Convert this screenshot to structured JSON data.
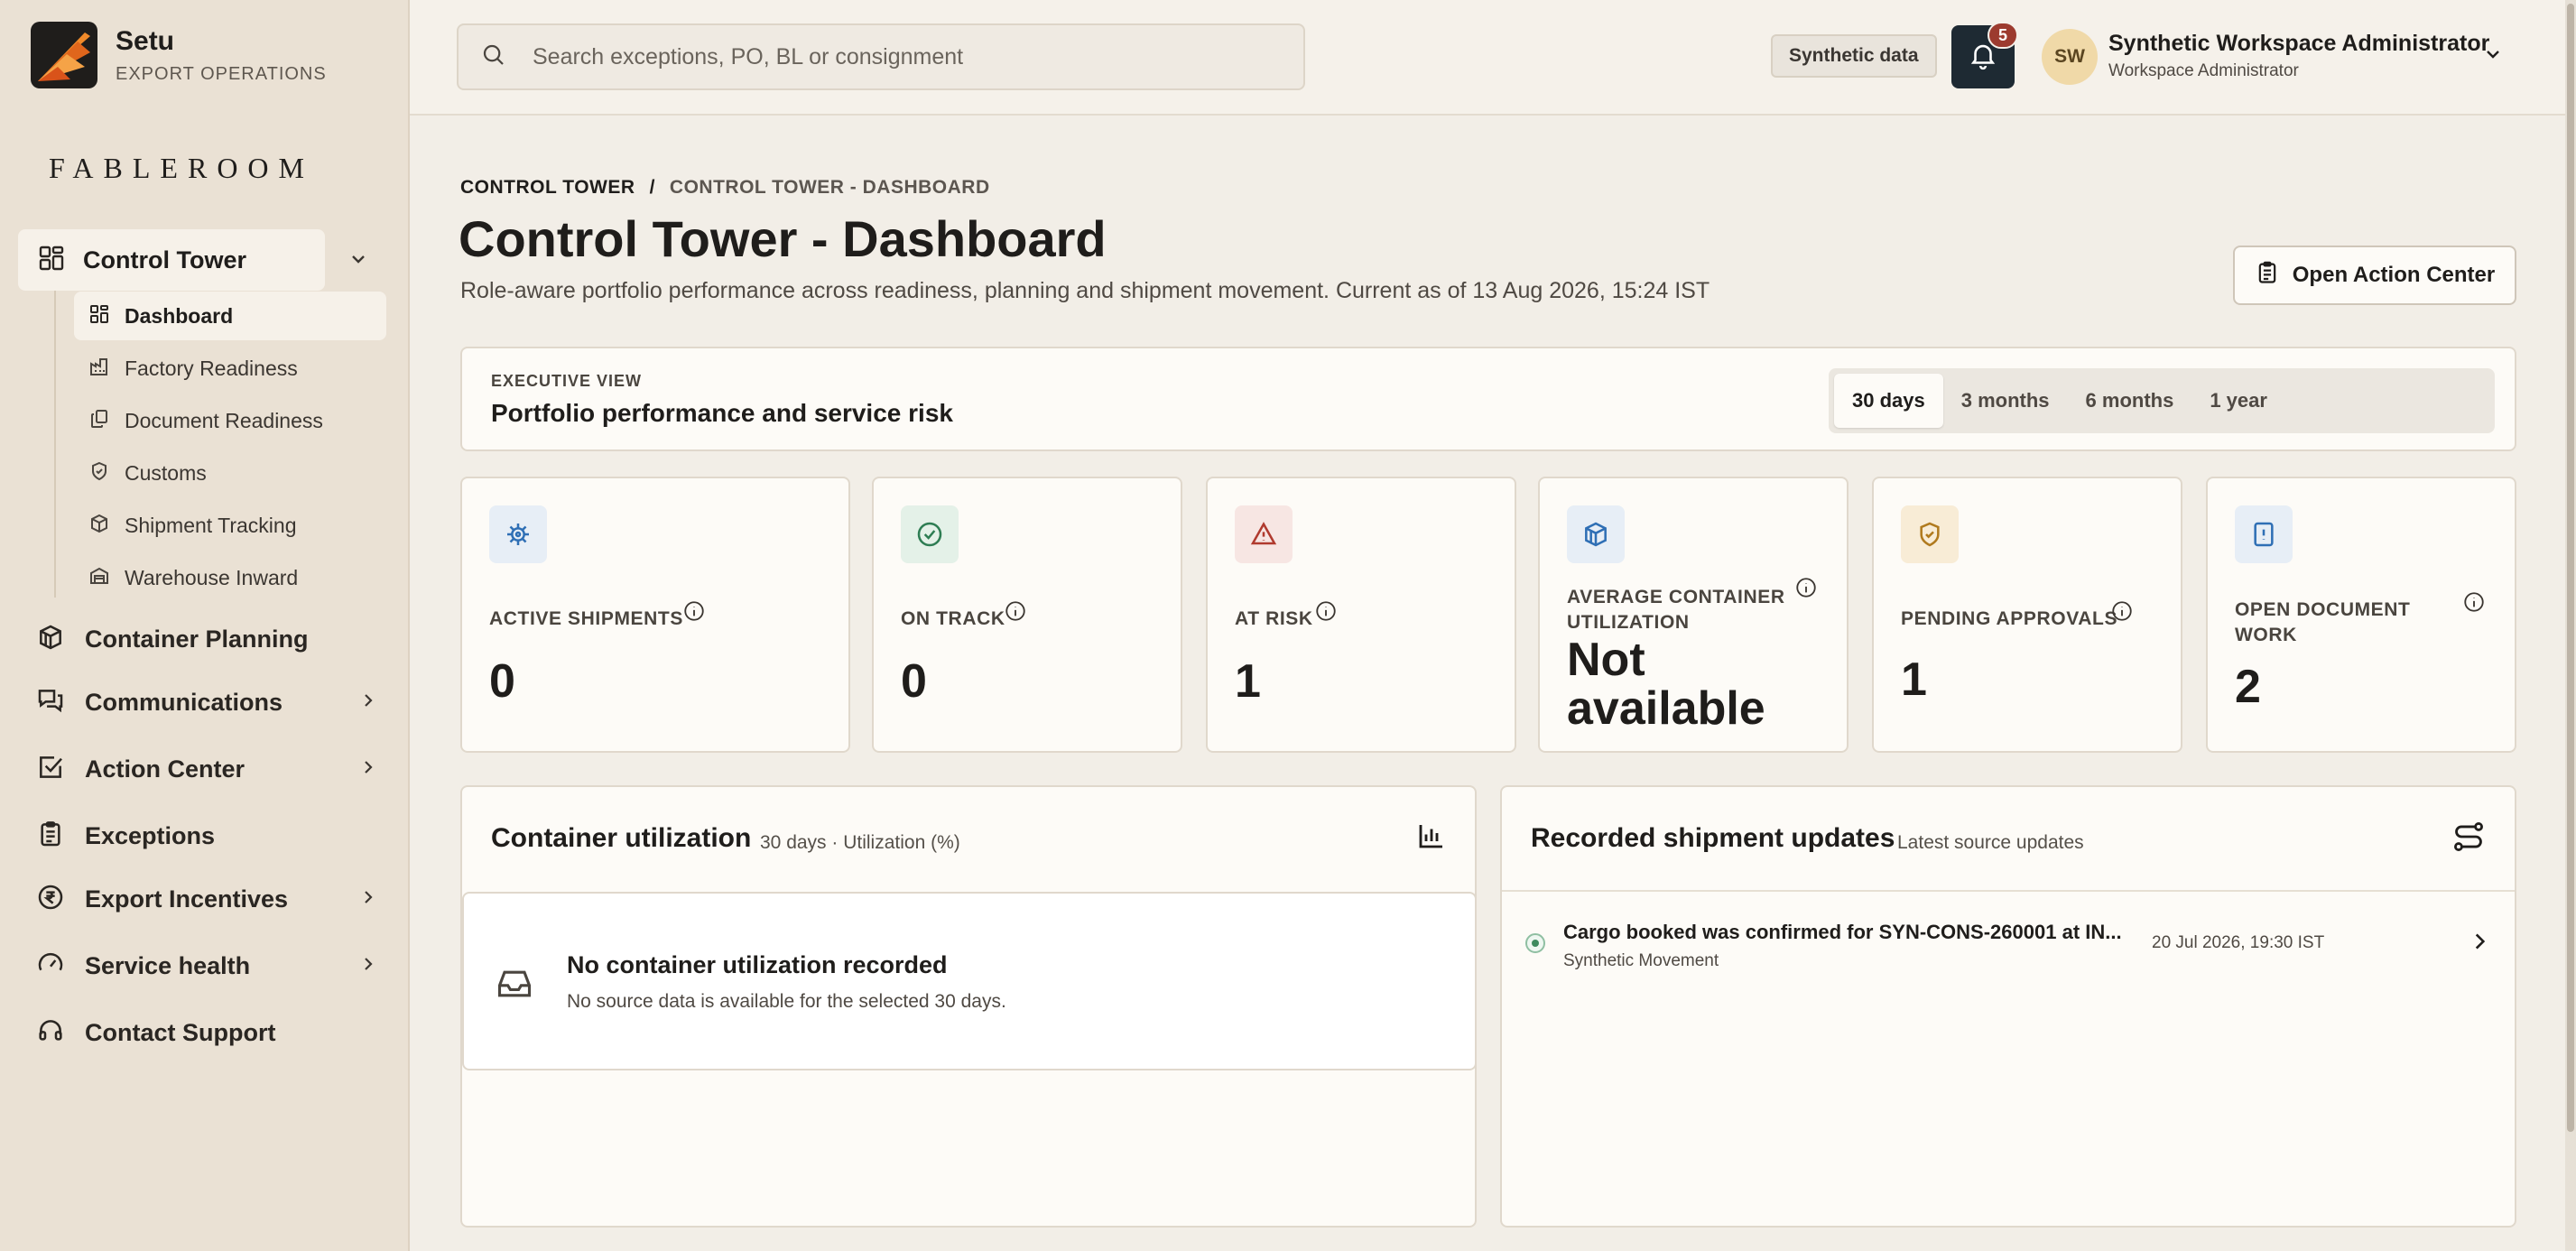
{
  "brand": {
    "name": "Setu",
    "subtitle": "EXPORT OPERATIONS",
    "wordmark": "FABLEROOM"
  },
  "sidebar": {
    "group": {
      "label": "Control Tower",
      "expanded": true
    },
    "sub_items": [
      {
        "label": "Dashboard",
        "active": true,
        "icon": "dashboard-icon"
      },
      {
        "label": "Factory Readiness",
        "icon": "factory-icon"
      },
      {
        "label": "Document Readiness",
        "icon": "documents-icon"
      },
      {
        "label": "Customs",
        "icon": "shield-icon"
      },
      {
        "label": "Shipment Tracking",
        "icon": "box-icon"
      },
      {
        "label": "Warehouse Inward",
        "icon": "warehouse-icon"
      }
    ],
    "items": [
      {
        "label": "Container Planning",
        "icon": "container-icon",
        "has_children": false
      },
      {
        "label": "Communications",
        "icon": "chat-icon",
        "has_children": true
      },
      {
        "label": "Action Center",
        "icon": "checklist-icon",
        "has_children": true
      },
      {
        "label": "Exceptions",
        "icon": "clipboard-icon",
        "has_children": false
      },
      {
        "label": "Export Incentives",
        "icon": "rupee-icon",
        "has_children": true
      },
      {
        "label": "Service health",
        "icon": "gauge-icon",
        "has_children": true
      },
      {
        "label": "Contact Support",
        "icon": "headset-icon",
        "has_children": false
      }
    ]
  },
  "topbar": {
    "search_placeholder": "Search exceptions, PO, BL or consignment",
    "synthetic_badge": "Synthetic data",
    "notification_count": "5",
    "user": {
      "initials": "SW",
      "name": "Synthetic Workspace Administrator",
      "role": "Workspace Administrator"
    }
  },
  "header": {
    "breadcrumb": [
      "CONTROL TOWER",
      "CONTROL TOWER - DASHBOARD"
    ],
    "breadcrumb_separator": "/",
    "title": "Control Tower - Dashboard",
    "subtitle": "Role-aware portfolio performance across readiness, planning and shipment movement. Current as of 13 Aug 2026, 15:24 IST",
    "action_button": "Open Action Center"
  },
  "executive": {
    "kicker": "EXECUTIVE VIEW",
    "title": "Portfolio performance and service risk",
    "ranges": [
      "30 days",
      "3 months",
      "6 months",
      "1 year"
    ],
    "selected_range": "30 days"
  },
  "kpis": [
    {
      "label": "ACTIVE SHIPMENTS",
      "value": "0",
      "icon": "ship-wheel-icon",
      "color": "#2f6fb5"
    },
    {
      "label": "ON TRACK",
      "value": "0",
      "icon": "check-circle-icon",
      "color": "#2e7d53"
    },
    {
      "label": "AT RISK",
      "value": "1",
      "icon": "warning-icon",
      "color": "#b03a2e"
    },
    {
      "label": "AVERAGE CONTAINER UTILIZATION",
      "value": "Not available",
      "icon": "container-icon",
      "color": "#2f6fb5"
    },
    {
      "label": "PENDING APPROVALS",
      "value": "1",
      "icon": "shield-check-icon",
      "color": "#b07a1e"
    },
    {
      "label": "OPEN DOCUMENT WORK",
      "value": "2",
      "icon": "document-alert-icon",
      "color": "#2f6fb5"
    }
  ],
  "utilization_panel": {
    "title": "Container utilization",
    "subtitle": "30 days · Utilization (%)",
    "empty_title": "No container utilization recorded",
    "empty_message": "No source data is available for the selected 30 days."
  },
  "updates_panel": {
    "title": "Recorded shipment updates",
    "subtitle": "Latest source updates",
    "items": [
      {
        "title": "Cargo booked was confirmed for SYN-CONS-260001 at IN...",
        "source": "Synthetic Movement",
        "time": "20 Jul 2026, 19:30 IST"
      }
    ]
  },
  "colors": {
    "sidebar_bg": "#eae1d4",
    "page_bg": "#f2eee7",
    "card_bg": "#fdfbf7",
    "accent_dark": "#1e2a33",
    "alert": "#9c3b2f"
  }
}
